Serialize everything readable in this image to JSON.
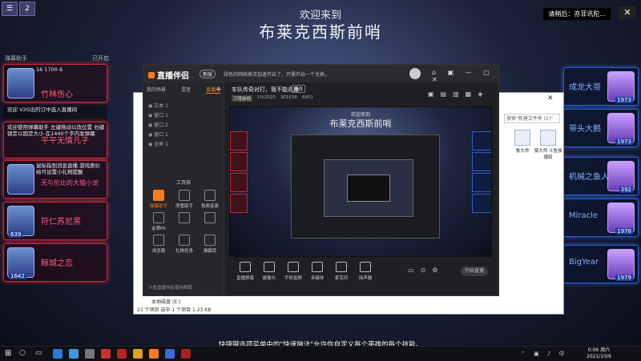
{
  "banner": {
    "welcome": "欢迎来到",
    "title": "布莱克西斯前哨",
    "status": "请稍后：亦菲讯陀..."
  },
  "top_left": {
    "count": "2"
  },
  "left_panel": {
    "header_left": "弹幕助手",
    "header_right": "已开启",
    "cards": [
      {
        "name": "竹林伤心",
        "num": "",
        "chat": "16 1700 6"
      },
      {
        "name": "",
        "num": "",
        "chat": "欢迎 V2G出的订中选入直播间"
      },
      {
        "name": "平平无情凡子",
        "num": "",
        "chat": "欢迎使用弹幕助手 左键拖动以改位置 右键锁定以固定大小 在1440个字内发弹幕"
      },
      {
        "name": "无与伦比的大猫小龙",
        "num": "",
        "chat": "鼠标指到消息直播 游戏原价给可设置小礼物提醒"
      },
      {
        "name": "符仁苏尼黑",
        "num": "639",
        "chat": ""
      },
      {
        "name": "鲸城之恋",
        "num": "1642",
        "chat": ""
      }
    ]
  },
  "right_panel": {
    "cards": [
      {
        "name": "成龙大哥",
        "num": "1973"
      },
      {
        "name": "带头大鹅",
        "num": "1973"
      },
      {
        "name": "机械之鱼人",
        "num": "392"
      },
      {
        "name": "Miracle",
        "num": "1978"
      },
      {
        "name": "BigYear",
        "num": "1979"
      }
    ]
  },
  "explorer": {
    "search": "搜索\"新建文件夹 (2)\"",
    "files": [
      "鲁大师",
      "猿大师 斗鱼独播版"
    ],
    "drive": "本地磁盘 (E:)",
    "status": "23 个项目   选中 1 个项目 1.23 KB"
  },
  "app": {
    "logo": "直播伴侣",
    "version": "新版",
    "notice": "绿色的网络推流加速开启了，只需开启一个兑换，",
    "tabs": [
      "我的场景",
      "混音",
      "直播间"
    ],
    "scenes": [
      "文本 1",
      "窗口 1",
      "窗口 2",
      "窗口 1",
      "全屏 1"
    ],
    "tools_title": "工具箱",
    "tools": [
      {
        "label": "弹幕助手",
        "hot": true
      },
      {
        "label": "房管助手",
        "hot": false
      },
      {
        "label": "视频连麦",
        "hot": false
      },
      {
        "label": "金牌PK",
        "hot": false
      },
      {
        "label": "",
        "hot": false
      },
      {
        "label": "",
        "hot": false
      },
      {
        "label": "浏览器",
        "hot": false
      },
      {
        "label": "礼物任务",
        "hot": false
      },
      {
        "label": "弹幕库",
        "hot": false
      }
    ],
    "tools_footer": "斗鱼直播伴侣使用帮助",
    "stream_title": "车队传奇对打，我不能退播",
    "stream_btn": "修改",
    "meta": {
      "tag": "刀塔前线",
      "viewers": "10/2020",
      "id": "301638",
      "hot": "6951"
    },
    "preview": {
      "welcome": "欢迎来到",
      "title": "布莱克西斯前哨"
    },
    "controls": [
      "直播屏幕",
      "摄像头",
      "手机投屏",
      "多媒体",
      "麦克风",
      "扬声器"
    ],
    "go_live": "开始直播"
  },
  "subtitle": "快捷键选项菜单中的\"快速施法\"允许你自定义每个英雄的每个技能。",
  "taskbar": {
    "time": "0:06 周六",
    "date": "2021/10/9"
  }
}
